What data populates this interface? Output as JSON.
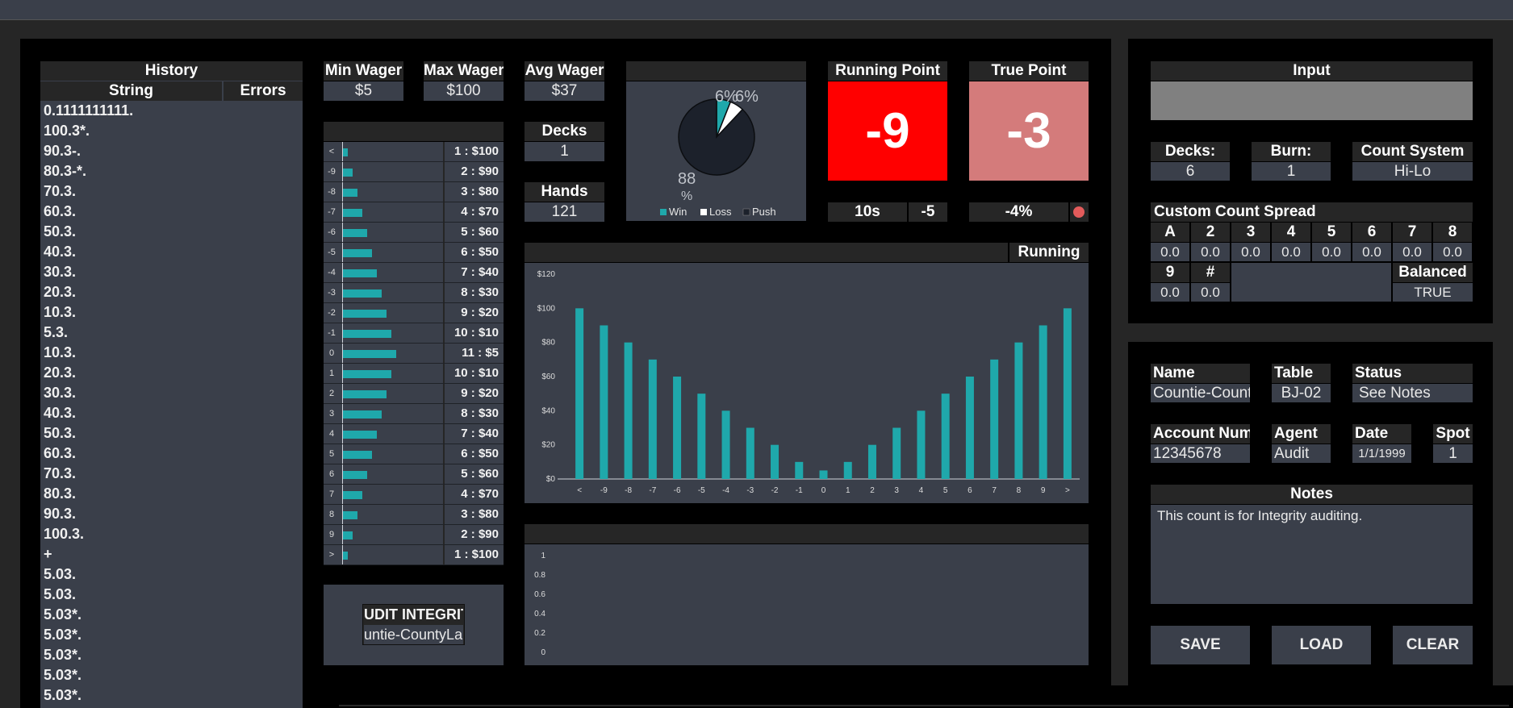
{
  "history": {
    "title": "History",
    "col_string": "String",
    "col_errors": "Errors",
    "items": [
      "0.1111111111.",
      "100.3*.",
      "90.3-.",
      "80.3-*.",
      "70.3.",
      "60.3.",
      "50.3.",
      "40.3.",
      "30.3.",
      "20.3.",
      "10.3.",
      "5.3.",
      "10.3.",
      "20.3.",
      "30.3.",
      "40.3.",
      "50.3.",
      "60.3.",
      "70.3.",
      "80.3.",
      "90.3.",
      "100.3.",
      "+",
      "5.03.",
      "5.03.",
      "5.03*.",
      "5.03*.",
      "5.03*.",
      "5.03*.",
      "5.03*."
    ]
  },
  "wagers": {
    "min_label": "Min Wager",
    "min_value": "$5",
    "max_label": "Max Wager",
    "max_value": "$100",
    "avg_label": "Avg Wager",
    "avg_value": "$37",
    "decks_label": "Decks",
    "decks_value": "1",
    "hands_label": "Hands",
    "hands_value": "121"
  },
  "bet_ladder": [
    {
      "label": "<",
      "units": 1,
      "bet": "$100"
    },
    {
      "label": "-9",
      "units": 2,
      "bet": "$90"
    },
    {
      "label": "-8",
      "units": 3,
      "bet": "$80"
    },
    {
      "label": "-7",
      "units": 4,
      "bet": "$70"
    },
    {
      "label": "-6",
      "units": 5,
      "bet": "$60"
    },
    {
      "label": "-5",
      "units": 6,
      "bet": "$50"
    },
    {
      "label": "-4",
      "units": 7,
      "bet": "$40"
    },
    {
      "label": "-3",
      "units": 8,
      "bet": "$30"
    },
    {
      "label": "-2",
      "units": 9,
      "bet": "$20"
    },
    {
      "label": "-1",
      "units": 10,
      "bet": "$10"
    },
    {
      "label": "0",
      "units": 11,
      "bet": "$5"
    },
    {
      "label": "1",
      "units": 10,
      "bet": "$10"
    },
    {
      "label": "2",
      "units": 9,
      "bet": "$20"
    },
    {
      "label": "3",
      "units": 8,
      "bet": "$30"
    },
    {
      "label": "4",
      "units": 7,
      "bet": "$40"
    },
    {
      "label": "5",
      "units": 6,
      "bet": "$50"
    },
    {
      "label": "6",
      "units": 5,
      "bet": "$60"
    },
    {
      "label": "7",
      "units": 4,
      "bet": "$70"
    },
    {
      "label": "8",
      "units": 3,
      "bet": "$80"
    },
    {
      "label": "9",
      "units": 2,
      "bet": "$90"
    },
    {
      "label": ">",
      "units": 1,
      "bet": "$100"
    }
  ],
  "audit": {
    "line1": "UDIT INTEGRIT",
    "line2": "untie-CountyLa"
  },
  "pie": {
    "slices": [
      {
        "name": "Win",
        "percent": 6,
        "color": "#1fa8ab"
      },
      {
        "name": "Loss",
        "percent": 6,
        "color": "#ffffff"
      },
      {
        "name": "Push",
        "percent": 88,
        "color": "#1c212b"
      }
    ],
    "label_win": "6%",
    "label_loss": "6%",
    "label_push": "88",
    "label_push_pct": "%",
    "legend": [
      "Win",
      "Loss",
      "Push"
    ]
  },
  "running_point": {
    "label": "Running Point",
    "value": "-9",
    "color": "#ff0000"
  },
  "true_point": {
    "label": "True Point",
    "value": "-3",
    "color": "#d47b7b"
  },
  "stats": {
    "tens": "10s",
    "minus5": "-5",
    "edge": "-4%",
    "indicator_color": "#e35b5b"
  },
  "running_chart_label": "Running",
  "chart_data": [
    {
      "type": "bar",
      "categories": [
        "<",
        "-9",
        "-8",
        "-7",
        "-6",
        "-5",
        "-4",
        "-3",
        "-2",
        "-1",
        "0",
        "1",
        "2",
        "3",
        "4",
        "5",
        "6",
        "7",
        "8",
        "9",
        ">"
      ],
      "values": [
        100,
        90,
        80,
        70,
        60,
        50,
        40,
        30,
        20,
        10,
        5,
        10,
        20,
        30,
        40,
        50,
        60,
        70,
        80,
        90,
        100
      ],
      "ylim": [
        0,
        120
      ],
      "yticks": [
        "$0",
        "$20",
        "$40",
        "$60",
        "$80",
        "$100",
        "$120"
      ],
      "grid": false,
      "color": "#1fa8ab"
    },
    {
      "type": "line",
      "values": [],
      "ylim": [
        0,
        1
      ],
      "yticks": [
        "0",
        "0.2",
        "0.4",
        "0.6",
        "0.8",
        "1"
      ]
    }
  ],
  "input": {
    "title": "Input",
    "decks_label": "Decks:",
    "decks_value": "6",
    "burn_label": "Burn:",
    "burn_value": "1",
    "system_label": "Count System",
    "system_value": "Hi-Lo",
    "spread_title": "Custom Count Spread",
    "cards": [
      "A",
      "2",
      "3",
      "4",
      "5",
      "6",
      "7",
      "8"
    ],
    "card_values": [
      "0.0",
      "0.0",
      "0.0",
      "0.0",
      "0.0",
      "0.0",
      "0.0",
      "0.0"
    ],
    "cards2": [
      "9",
      "#"
    ],
    "card_values2": [
      "0.0",
      "0.0"
    ],
    "balanced_label": "Balanced",
    "balanced_value": "TRUE"
  },
  "info": {
    "name_label": "Name",
    "name_value": "Countie-Count",
    "table_label": "Table",
    "table_value": "BJ-02",
    "status_label": "Status",
    "status_value": "See Notes",
    "account_label": "Account Num",
    "account_value": "12345678",
    "agent_label": "Agent",
    "agent_value": "Audit",
    "date_label": "Date",
    "date_value": "1/1/1999",
    "spot_label": "Spot",
    "spot_value": "1",
    "notes_label": "Notes",
    "notes_value": "This count is for Integrity auditing."
  },
  "buttons": {
    "save": "SAVE",
    "load": "LOAD",
    "clear": "CLEAR"
  }
}
